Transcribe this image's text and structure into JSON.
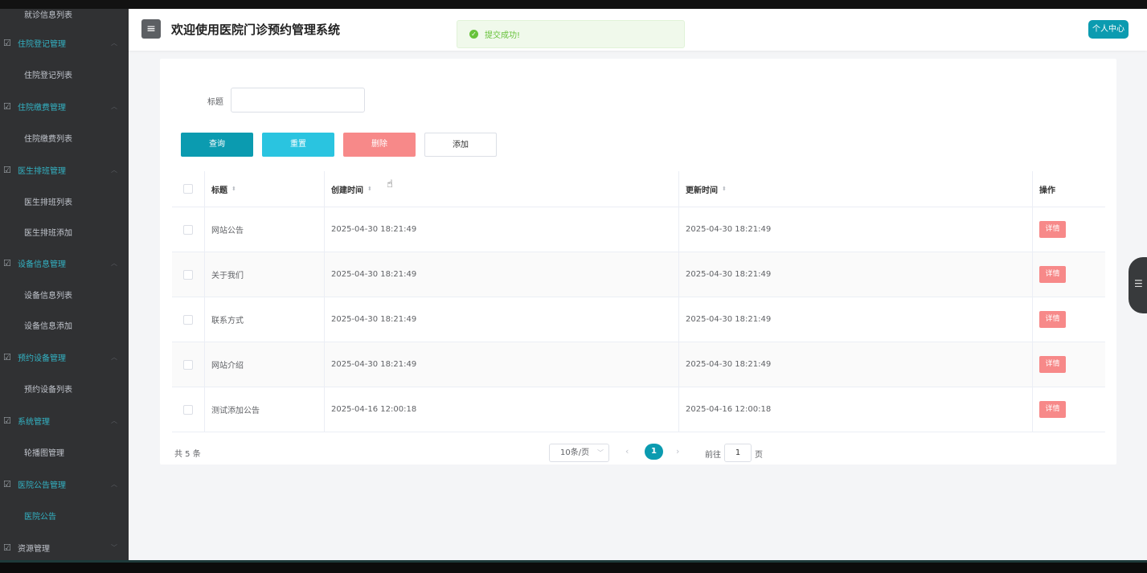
{
  "sidebar": {
    "cut_top_label": "就诊信息列表",
    "groups": [
      {
        "label": "住院登记管理",
        "items": [
          "住院登记列表"
        ]
      },
      {
        "label": "住院缴费管理",
        "items": [
          "住院缴费列表"
        ]
      },
      {
        "label": "医生排班管理",
        "items": [
          "医生排班列表",
          "医生排班添加"
        ]
      },
      {
        "label": "设备信息管理",
        "items": [
          "设备信息列表",
          "设备信息添加"
        ]
      },
      {
        "label": "预约设备管理",
        "items": [
          "预约设备列表"
        ]
      },
      {
        "label": "系统管理",
        "items": [
          "轮播图管理"
        ]
      },
      {
        "label": "医院公告管理",
        "items": [
          "医院公告"
        ]
      },
      {
        "label": "资源管理",
        "items": []
      }
    ],
    "active_item": "医院公告"
  },
  "header": {
    "menu_icon": "hamburger-icon",
    "title": "欢迎使用医院门诊预约管理系统",
    "toast": "提交成功!",
    "profile_button": "个人中心"
  },
  "filter": {
    "title_label": "标题",
    "title_value": ""
  },
  "buttons": {
    "query": "查询",
    "reset": "重置",
    "delete": "删除",
    "add": "添加"
  },
  "table": {
    "columns": [
      "标题",
      "创建时间",
      "更新时间",
      "操作"
    ],
    "rows": [
      {
        "title": "网站公告",
        "created": "2025-04-30 18:21:49",
        "updated": "2025-04-30 18:21:49",
        "action": "详情"
      },
      {
        "title": "关于我们",
        "created": "2025-04-30 18:21:49",
        "updated": "2025-04-30 18:21:49",
        "action": "详情"
      },
      {
        "title": "联系方式",
        "created": "2025-04-30 18:21:49",
        "updated": "2025-04-30 18:21:49",
        "action": "详情"
      },
      {
        "title": "网站介绍",
        "created": "2025-04-30 18:21:49",
        "updated": "2025-04-30 18:21:49",
        "action": "详情"
      },
      {
        "title": "测试添加公告",
        "created": "2025-04-16 12:00:18",
        "updated": "2025-04-16 12:00:18",
        "action": "详情"
      }
    ]
  },
  "pagination": {
    "total": "共 5 条",
    "page_size": "10条/页",
    "current_page": "1",
    "goto_label": "前往",
    "goto_value": "1",
    "goto_suffix": "页"
  },
  "colors": {
    "primary": "#0b9bb0",
    "reset": "#2ac4e0",
    "danger": "#f78989",
    "sidebar_bg": "#303133",
    "sidebar_accent": "#33b3c4",
    "success": "#67c23a"
  }
}
